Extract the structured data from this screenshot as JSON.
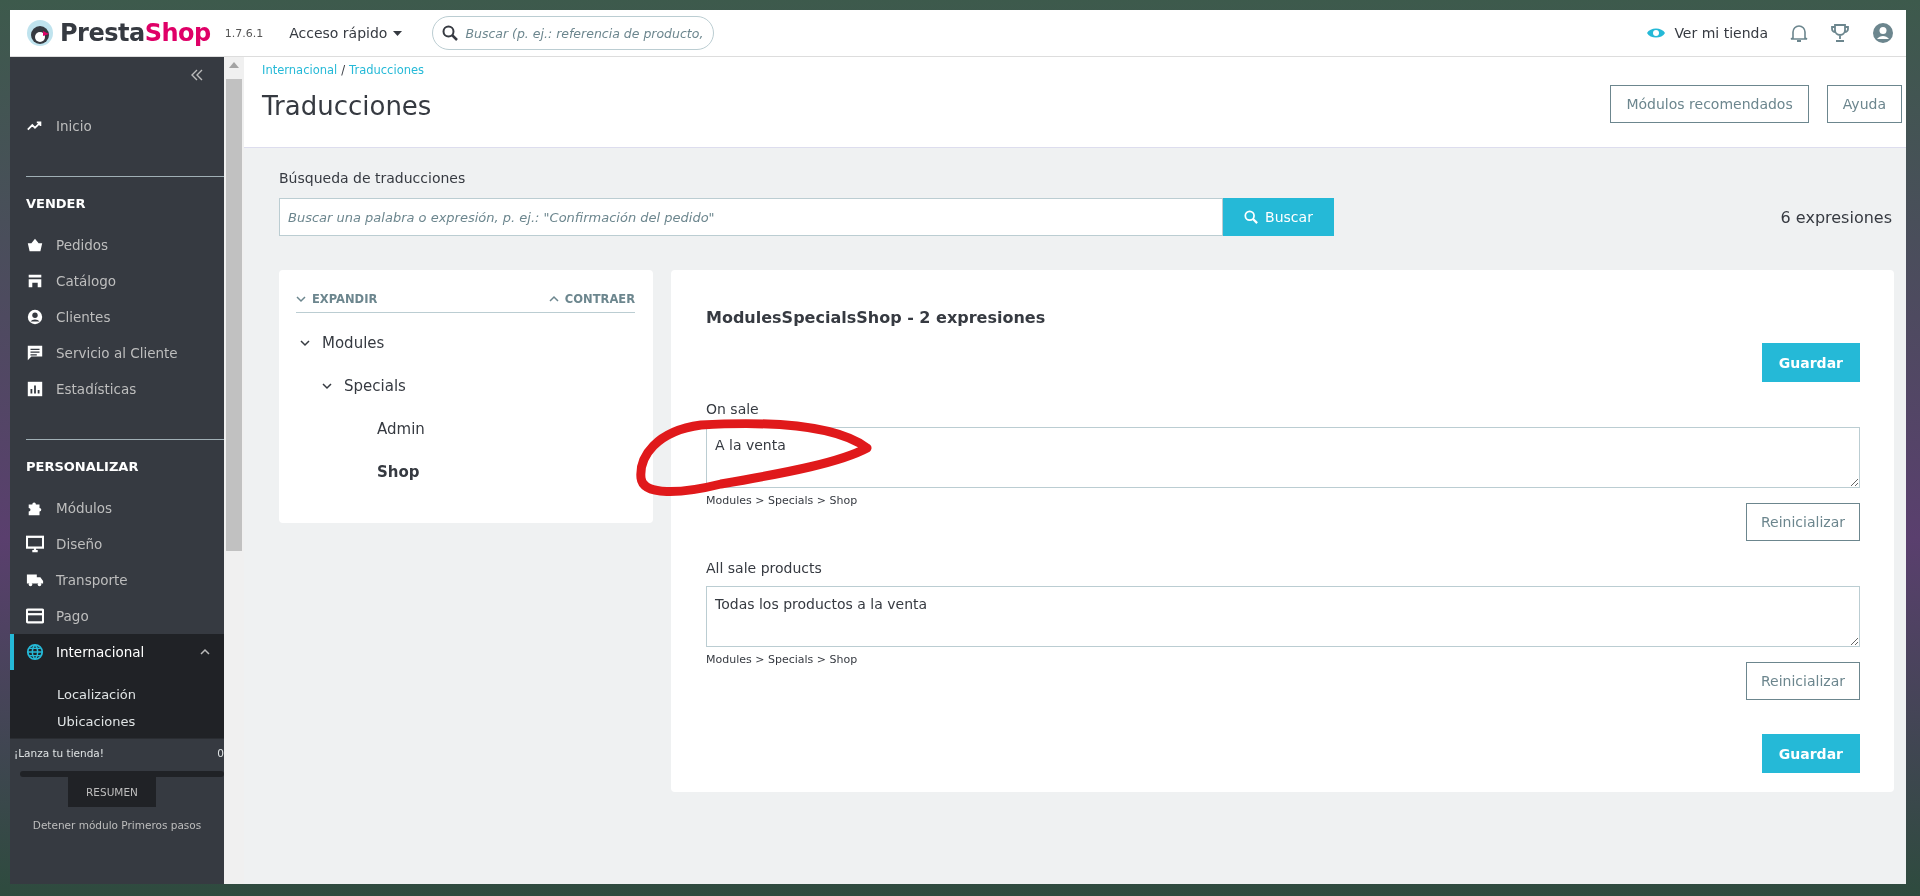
{
  "header": {
    "logo_text": [
      "Presta",
      "Shop"
    ],
    "version": "1.7.6.1",
    "quick_access": "Acceso rápido",
    "search": {
      "placeholder": "Buscar (p. ej.: referencia de producto,"
    },
    "view_store": "Ver mi tienda"
  },
  "sidebar": {
    "sections": [
      {
        "items": [
          {
            "label": "Inicio",
            "selected": false,
            "expanded": false
          }
        ]
      },
      {
        "title": "VENDER",
        "items": [
          {
            "label": "Pedidos",
            "selected": false,
            "expanded": false
          },
          {
            "label": "Catálogo",
            "selected": false,
            "expanded": false
          },
          {
            "label": "Clientes",
            "selected": false,
            "expanded": false
          },
          {
            "label": "Servicio al Cliente",
            "selected": false,
            "expanded": false
          },
          {
            "label": "Estadísticas",
            "selected": false,
            "expanded": false
          }
        ]
      },
      {
        "title": "PERSONALIZAR",
        "items": [
          {
            "label": "Módulos",
            "selected": false,
            "expanded": false
          },
          {
            "label": "Diseño",
            "selected": false,
            "expanded": false
          },
          {
            "label": "Transporte",
            "selected": false,
            "expanded": false
          },
          {
            "label": "Pago",
            "selected": false,
            "expanded": false
          },
          {
            "label": "Internacional",
            "selected": true,
            "expanded": true,
            "children": [
              {
                "label": "Localización"
              },
              {
                "label": "Ubicaciones"
              }
            ]
          }
        ]
      }
    ],
    "launch": {
      "title": "¡Lanza tu tienda!",
      "percent": "0",
      "level": 0,
      "button": "RESUMEN",
      "link": "Detener módulo Primeros pasos"
    }
  },
  "page": {
    "breadcrumb": [
      "Internacional",
      "Traducciones"
    ],
    "breadcrumb_separator": "/",
    "title": "Traducciones",
    "buttons": [
      "Módulos recomendados",
      "Ayuda"
    ]
  },
  "search": {
    "label": "Búsqueda de traducciones",
    "placeholder": "Buscar una palabra o expresión, p. ej.: \"Confirmación del pedido\"",
    "button": "Buscar",
    "count": "6 expresiones"
  },
  "tree": {
    "expand": "EXPANDIR",
    "collapse": "CONTRAER",
    "nodes": [
      {
        "label": "Modules",
        "expanded": true,
        "selected": false,
        "children": [
          {
            "label": "Specials",
            "expanded": true,
            "selected": false,
            "children": [
              {
                "label": "Admin",
                "selected": false
              },
              {
                "label": "Shop",
                "selected": true
              }
            ]
          }
        ]
      }
    ]
  },
  "translations": {
    "title": "ModulesSpecialsShop - 2 expresiones",
    "save_top": "Guardar",
    "save_bottom": "Guardar",
    "entries": [
      {
        "label": "On sale",
        "value": "A la venta",
        "path": "Modules > Specials > Shop",
        "reset": "Reinicializar"
      },
      {
        "label": "All sale products",
        "value": "Todas los productos a la venta",
        "path": "Modules > Specials > Shop",
        "reset": "Reinicializar"
      }
    ]
  }
}
